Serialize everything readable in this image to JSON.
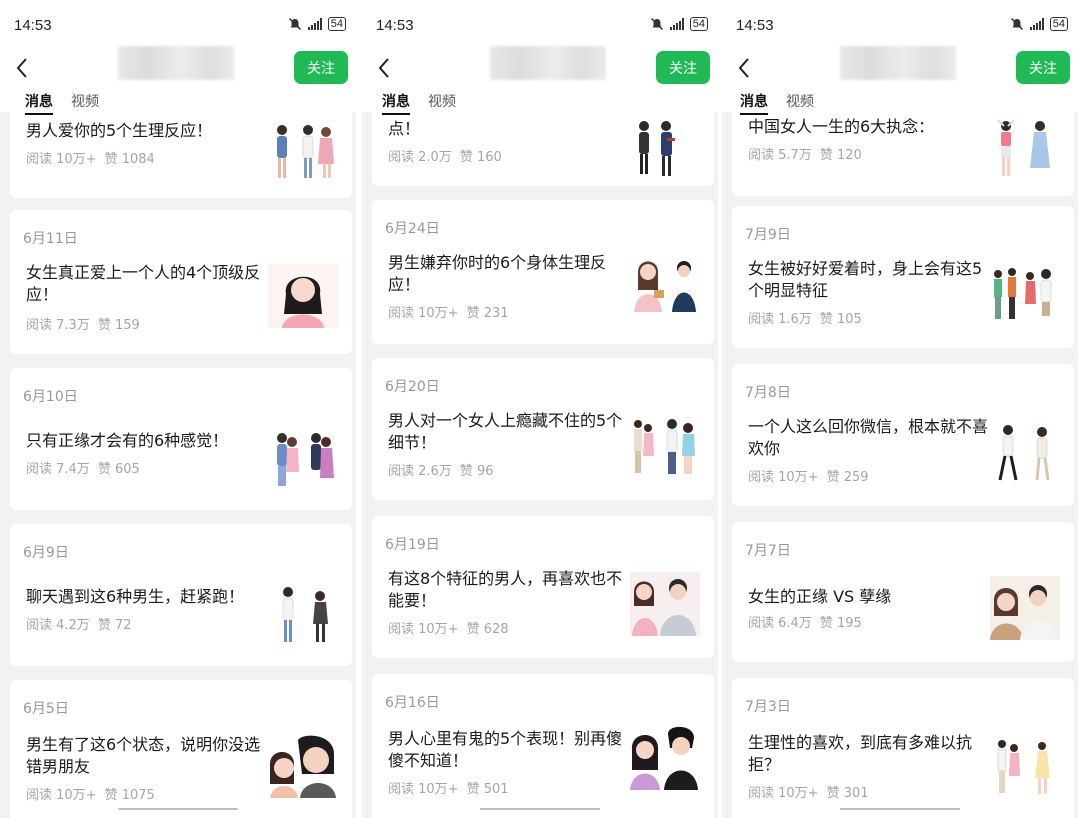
{
  "screens": [
    {
      "time": "14:53",
      "battery": "54",
      "follow_label": "关注",
      "tabs": [
        "消息",
        "视频"
      ],
      "items": [
        {
          "date": "",
          "title": "男人爱你的5个生理反应！",
          "reads": "阅读 10万+",
          "likes": "赞 1084",
          "thumb": "couple-illustration-icon"
        },
        {
          "date": "6月11日",
          "title": "女生真正爱上一个人的4个顶级反应！",
          "reads": "阅读 7.3万",
          "likes": "赞 159",
          "thumb": "girl-portrait-icon"
        },
        {
          "date": "6月10日",
          "title": "只有正缘才会有的6种感觉！",
          "reads": "阅读 7.4万",
          "likes": "赞 605",
          "thumb": "couple-illustration-icon"
        },
        {
          "date": "6月9日",
          "title": "聊天遇到这6种男生，赶紧跑！",
          "reads": "阅读 4.2万",
          "likes": "赞 72",
          "thumb": "couple-illustration-icon"
        },
        {
          "date": "6月5日",
          "title": "男生有了这6个状态，说明你没选错男朋友",
          "reads": "阅读 10万+",
          "likes": "赞 1075",
          "thumb": "couple-portrait-icon"
        }
      ]
    },
    {
      "time": "14:53",
      "battery": "54",
      "follow_label": "关注",
      "tabs": [
        "消息",
        "视频"
      ],
      "items": [
        {
          "date": "",
          "title": "点！",
          "reads": "阅读 2.0万",
          "likes": "赞 160",
          "thumb": "couple-illustration-icon"
        },
        {
          "date": "6月24日",
          "title": "男生嫌弃你时的6个身体生理反应！",
          "reads": "阅读 10万+",
          "likes": "赞 231",
          "thumb": "couple-illustration-icon"
        },
        {
          "date": "6月20日",
          "title": "男人对一个女人上瘾藏不住的5个细节！",
          "reads": "阅读 2.6万",
          "likes": "赞 96",
          "thumb": "couple-illustration-icon"
        },
        {
          "date": "6月19日",
          "title": "有这8个特征的男人，再喜欢也不能要！",
          "reads": "阅读 10万+",
          "likes": "赞 628",
          "thumb": "couple-illustration-icon"
        },
        {
          "date": "6月16日",
          "title": "男人心里有鬼的5个表现！别再傻傻不知道！",
          "reads": "阅读 10万+",
          "likes": "赞 501",
          "thumb": "couple-portrait-icon"
        }
      ]
    },
    {
      "time": "14:53",
      "battery": "54",
      "follow_label": "关注",
      "tabs": [
        "消息",
        "视频"
      ],
      "items": [
        {
          "date": "",
          "title": "中国女人一生的6大执念：",
          "reads": "阅读 5.7万",
          "likes": "赞 120",
          "thumb": "couple-illustration-icon"
        },
        {
          "date": "7月9日",
          "title": "女生被好好爱着时，身上会有这5个明显特征",
          "reads": "阅读 1.6万",
          "likes": "赞 105",
          "thumb": "couple-illustration-icon"
        },
        {
          "date": "7月8日",
          "title": "一个人这么回你微信，根本就不喜欢你",
          "reads": "阅读 10万+",
          "likes": "赞 259",
          "thumb": "couple-illustration-icon"
        },
        {
          "date": "7月7日",
          "title": "女生的正缘 VS 孽缘",
          "reads": "阅读 6.4万",
          "likes": "赞 195",
          "thumb": "couple-portrait-icon"
        },
        {
          "date": "7月3日",
          "title": "生理性的喜欢，到底有多难以抗拒？",
          "reads": "阅读 10万+",
          "likes": "赞 301",
          "thumb": "couple-illustration-icon"
        }
      ]
    }
  ],
  "colors": {
    "follow_green": "#1fba55",
    "meta_gray": "#a5a5a5",
    "date_gray": "#999999"
  }
}
